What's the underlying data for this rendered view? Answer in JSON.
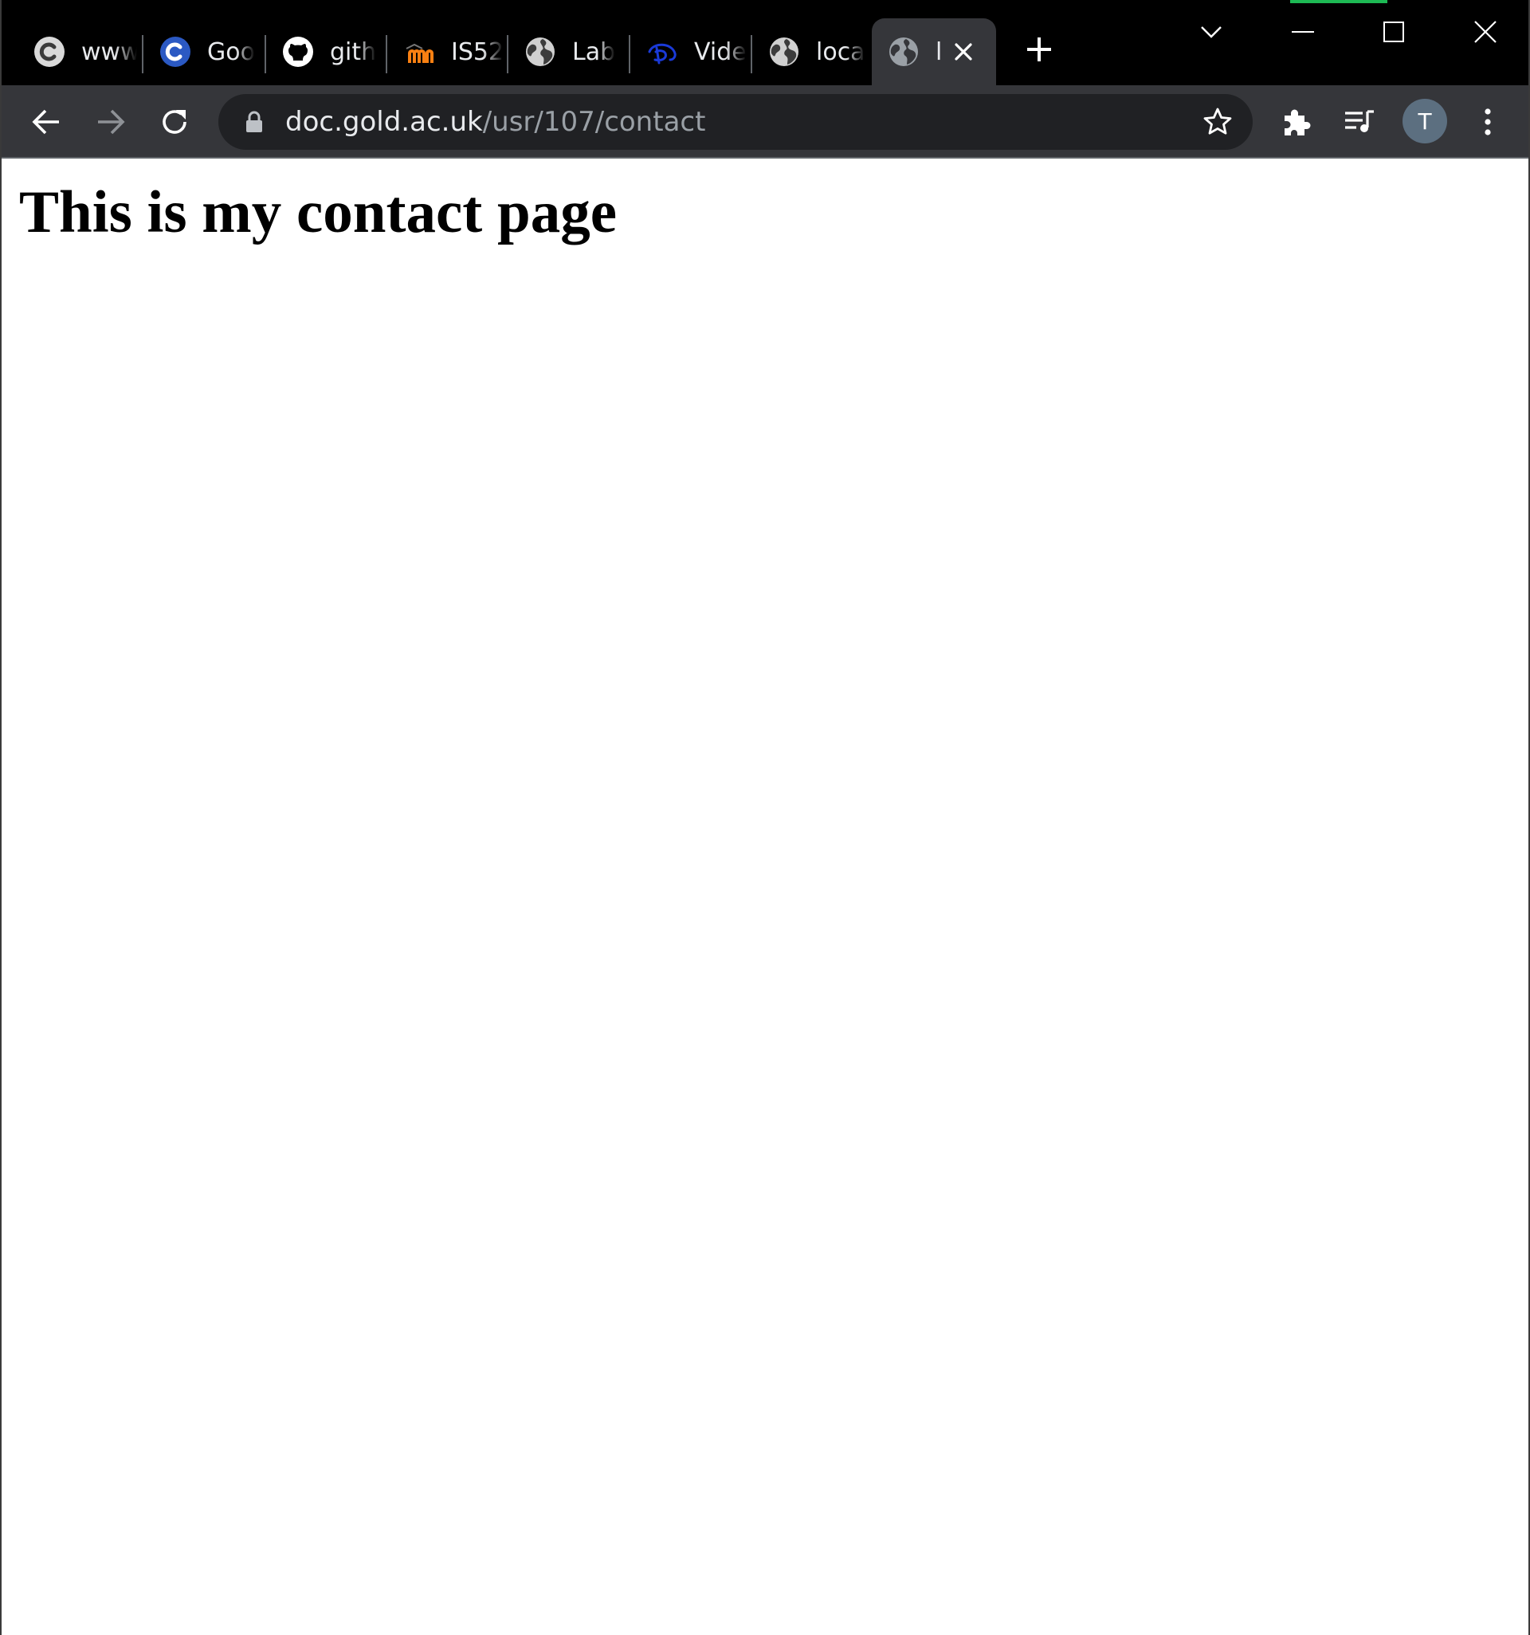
{
  "browser": {
    "tabs": [
      {
        "label": "www",
        "icon": "c-logo-gray-icon"
      },
      {
        "label": "Goo",
        "icon": "c-logo-blue-icon"
      },
      {
        "label": "gith",
        "icon": "github-icon"
      },
      {
        "label": "IS52",
        "icon": "moodle-icon"
      },
      {
        "label": "Lab",
        "icon": "globe-icon"
      },
      {
        "label": "Vide",
        "icon": "disney-plus-icon"
      },
      {
        "label": "loca",
        "icon": "globe-icon"
      },
      {
        "label": "l",
        "icon": "globe-icon",
        "active": true
      }
    ],
    "address_bar": {
      "host": "doc.gold.ac.uk",
      "path": "/usr/107/contact"
    },
    "profile_initial": "T",
    "colors": {
      "accent": "#1db954",
      "tab_strip": "#000000",
      "toolbar": "#35363a",
      "omnibox": "#202124"
    }
  },
  "page": {
    "heading": "This is my contact page"
  }
}
